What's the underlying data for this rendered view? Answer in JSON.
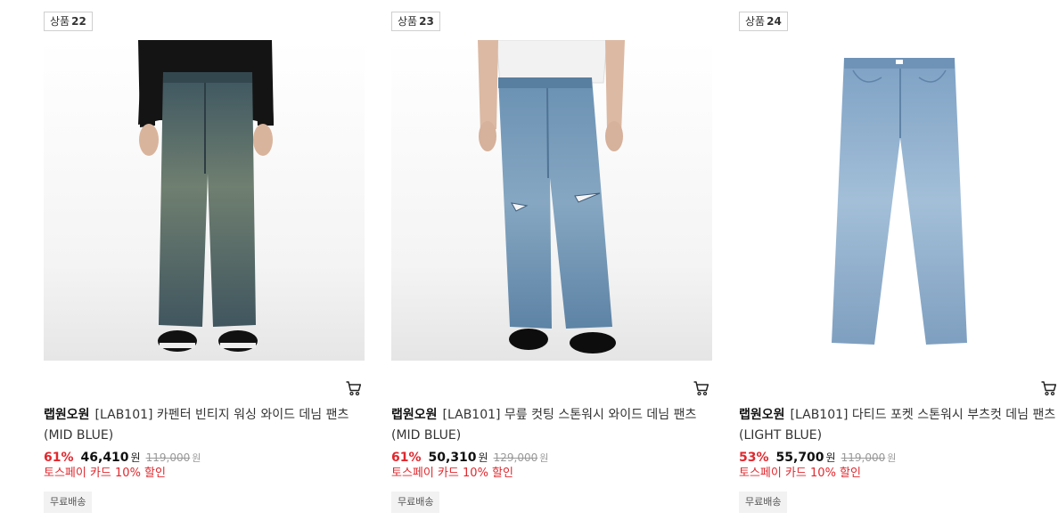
{
  "products": [
    {
      "rank_prefix": "상품",
      "rank_number": "22",
      "brand": "랩원오원",
      "name": "[LAB101] 카펜터 빈티지 워싱 와이드 데님 팬츠 (MID BLUE)",
      "discount_rate": "61%",
      "sale_price": "46,410",
      "currency": "원",
      "original_price": "119,000",
      "original_currency": "원",
      "promotion": "토스페이 카드 10% 할인",
      "shipping_tag": "무료배송",
      "cart_icon": "cart-icon"
    },
    {
      "rank_prefix": "상품",
      "rank_number": "23",
      "brand": "랩원오원",
      "name": "[LAB101] 무릎 컷팅 스톤워시 와이드 데님 팬츠 (MID BLUE)",
      "discount_rate": "61%",
      "sale_price": "50,310",
      "currency": "원",
      "original_price": "129,000",
      "original_currency": "원",
      "promotion": "토스페이 카드 10% 할인",
      "shipping_tag": "무료배송",
      "cart_icon": "cart-icon"
    },
    {
      "rank_prefix": "상품",
      "rank_number": "24",
      "brand": "랩원오원",
      "name": "[LAB101] 다티드 포켓 스톤워시 부츠컷 데님 팬츠 (LIGHT BLUE)",
      "discount_rate": "53%",
      "sale_price": "55,700",
      "currency": "원",
      "original_price": "119,000",
      "original_currency": "원",
      "promotion": "토스페이 카드 10% 할인",
      "shipping_tag": "무료배송",
      "cart_icon": "cart-icon"
    }
  ],
  "colors": {
    "discount": "#e0282e",
    "promotion": "#e0282e",
    "tag_bg": "#f2f2f2",
    "strikethrough": "#999999"
  }
}
